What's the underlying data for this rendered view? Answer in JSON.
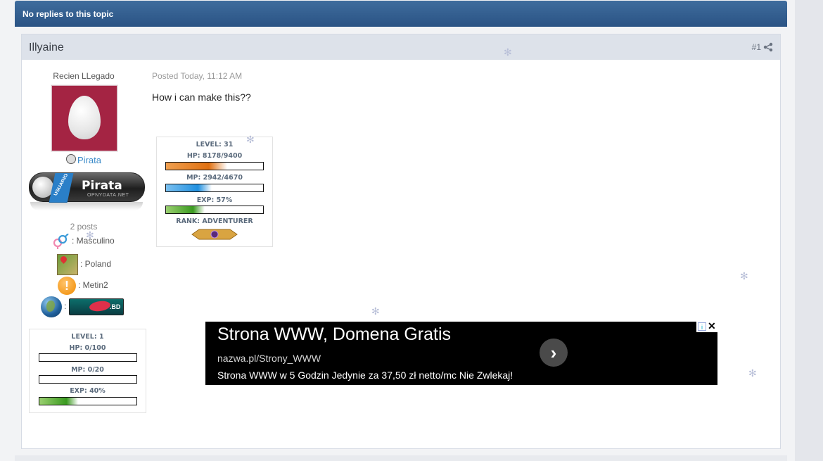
{
  "topic_header": {
    "title": "No replies to this topic"
  },
  "post": {
    "author": "Illyaine",
    "number": "#1",
    "posted": "Posted Today, 11:12 AM",
    "body": "How i can make this??"
  },
  "profile": {
    "rank_title": "Recien LLegado",
    "group": "Pirata",
    "badge": {
      "ribbon": "USUARIO",
      "text": "Pirata",
      "subtext": "OPNYDATA.NET"
    },
    "posts": "2 posts",
    "gender": ": Masculino",
    "location": ": Poland",
    "interest": ": Metin2",
    "country_sep": ":",
    "country_flag_text": ".BD"
  },
  "user_stats": {
    "level": "LEVEL: 1",
    "hp": "HP: 0/100",
    "mp": "MP: 0/20",
    "exp": "EXP: 40%",
    "hp_fraction": 0,
    "mp_fraction": 0,
    "exp_fraction": 0.4
  },
  "signature_stats": {
    "level": "LEVEL: 31",
    "hp": "HP: 8178/9400",
    "mp": "MP: 2942/4670",
    "exp": "EXP: 57%",
    "rank": "RANK: ADVENTURER",
    "hp_fraction": 0.63,
    "mp_fraction": 0.47,
    "exp_fraction": 0.4
  },
  "ad": {
    "title": "Strona WWW, Domena Gratis",
    "url": "nazwa.pl/Strony_WWW",
    "description": "Strona WWW w 5 Godzin Jedynie za 37,50 zł netto/mc Nie Zwlekaj!",
    "info_icon": "i",
    "close_icon": "✕",
    "arrow_icon": "›"
  },
  "colors": {
    "header_blue": "#2f5b8c",
    "ad_bg": "#000000",
    "avatar_bg": "#a42443"
  }
}
